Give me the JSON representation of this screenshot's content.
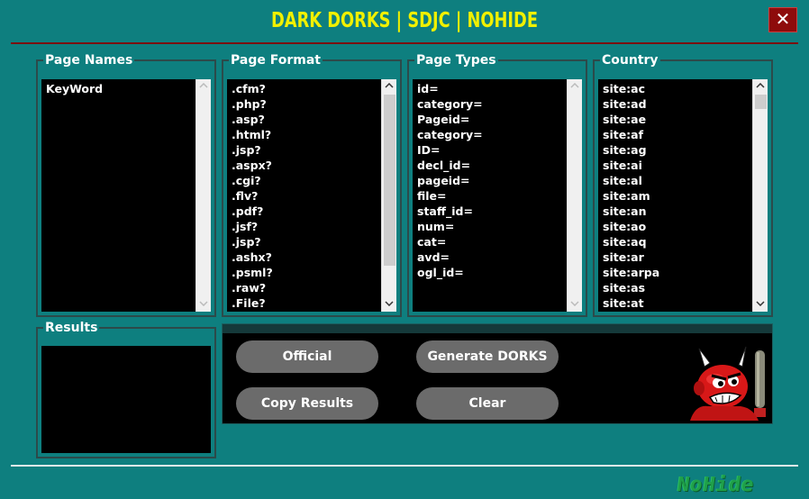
{
  "window": {
    "title": "DARK DORKS | SDJC | NOHIDE",
    "close_label": "✕"
  },
  "groups": {
    "page_names": {
      "label": "Page Names",
      "items": [
        "KeyWord"
      ]
    },
    "page_format": {
      "label": "Page Format",
      "items": [
        ".cfm?",
        ".php?",
        ".asp?",
        ".html?",
        ".jsp?",
        ".aspx?",
        ".cgi?",
        ".flv?",
        ".pdf?",
        ".jsf?",
        ".jsp?",
        ".ashx?",
        ".psml?",
        ".raw?",
        ".File?"
      ]
    },
    "page_types": {
      "label": "Page Types",
      "items": [
        "id=",
        "category=",
        "Pageid=",
        "category=",
        "ID=",
        "decl_id=",
        "pageid=",
        "file=",
        "staff_id=",
        "num=",
        "cat=",
        "avd=",
        "ogl_id="
      ]
    },
    "country": {
      "label": "Country",
      "items": [
        "site:ac",
        "site:ad",
        "site:ae",
        "site:af",
        "site:ag",
        "site:ai",
        "site:al",
        "site:am",
        "site:an",
        "site:ao",
        "site:aq",
        "site:ar",
        "site:arpa",
        "site:as",
        "site:at"
      ]
    },
    "results": {
      "label": "Results"
    }
  },
  "buttons": {
    "official": "Official",
    "generate": "Generate DORKS",
    "copy": "Copy Results",
    "clear": "Clear"
  },
  "brand": {
    "text": "NoHide"
  },
  "colors": {
    "background": "#0e7f7f",
    "title": "#f0f000",
    "close_button": "#8e0b0b",
    "button": "#6b6b6b",
    "list_background": "#000000"
  },
  "icons": {
    "mascot": "devil-mascot-icon",
    "scroll_up": "chevron-up-icon",
    "scroll_down": "chevron-down-icon"
  }
}
